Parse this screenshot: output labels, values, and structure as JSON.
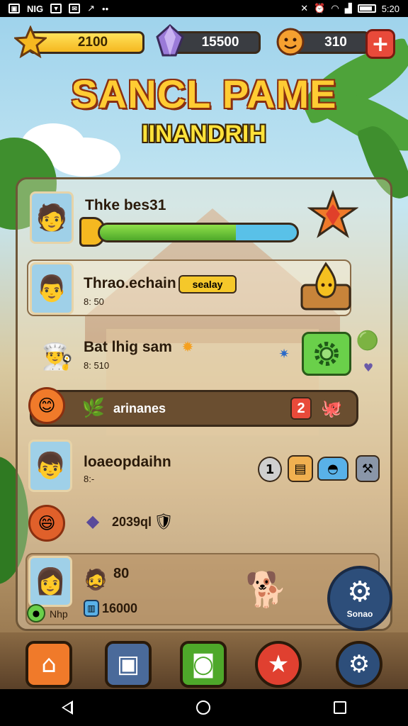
{
  "status_bar": {
    "left_icons": [
      "gallery-icon",
      "nfc-icon",
      "message-icon",
      "mail-icon",
      "missed-call-icon",
      "more-dots-icon"
    ],
    "left_texts": [
      "NIG"
    ],
    "time": "5:20"
  },
  "resources": {
    "gold": "2100",
    "gems": "15500",
    "lives": "310"
  },
  "titles": {
    "main": "SANCL PAME",
    "sub": "IINANDRIH"
  },
  "rows": [
    {
      "label": "Thke bes31",
      "progress": 0.69
    },
    {
      "label": "Thrao.echain",
      "badge": "sealay",
      "sub": "8:  50"
    },
    {
      "label": "Bat lhig sam",
      "sub": "8: 510"
    },
    {
      "label": "arinanes",
      "count": "2"
    },
    {
      "label": "loaeopdaihn",
      "sub": "8:-",
      "counter": "1"
    },
    {
      "label": "2039ql"
    },
    {
      "label": "80",
      "sub": "16000",
      "avatar_caption": "Nhp"
    }
  ],
  "settings_button": "Sonao",
  "nav": [
    "home",
    "backpack",
    "shop",
    "achievements",
    "settings"
  ],
  "colors": {
    "gold_bar": "#f5b820",
    "progress_green": "#4ea82a",
    "progress_blue": "#59c1e8",
    "plus_red": "#e84a3a",
    "nav_orange": "#f07a2a",
    "nav_blue": "#4a6a9a",
    "nav_green": "#4ea82a",
    "nav_red": "#e04030",
    "nav_navy": "#2d4e7a"
  }
}
